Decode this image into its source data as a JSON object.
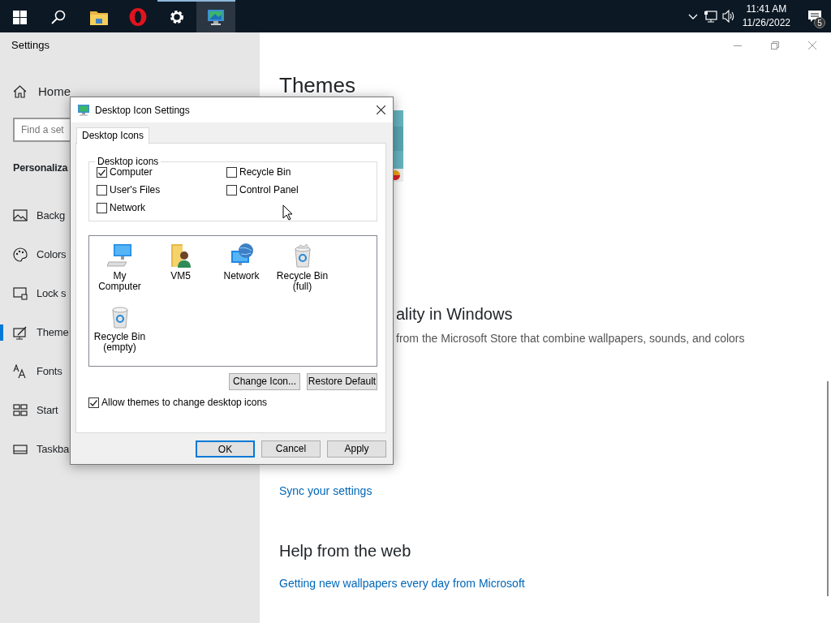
{
  "taskbar": {
    "apps": [
      {
        "kind": "start",
        "running": false,
        "selected": false
      },
      {
        "kind": "search",
        "running": false,
        "selected": false
      },
      {
        "kind": "folder",
        "running": false,
        "selected": false
      },
      {
        "kind": "browser",
        "running": false,
        "selected": false
      },
      {
        "kind": "settings",
        "running": true,
        "selected": false
      },
      {
        "kind": "display",
        "running": true,
        "selected": true
      }
    ],
    "tray": {
      "time": "11:41 AM",
      "date": "11/26/2022",
      "notification_count": "5"
    }
  },
  "settings_window": {
    "title": "Settings",
    "home": "Home",
    "search": {
      "placeholder": "Find a set"
    },
    "section": "Personaliza",
    "nav": [
      {
        "kind": "background",
        "label": "Backg",
        "selected": false
      },
      {
        "kind": "colors",
        "label": "Colors",
        "selected": false
      },
      {
        "kind": "lock",
        "label": "Lock s",
        "selected": false
      },
      {
        "kind": "themes",
        "label": "Theme",
        "selected": true
      },
      {
        "kind": "fonts",
        "label": "Fonts",
        "selected": false
      },
      {
        "kind": "start",
        "label": "Start",
        "selected": false
      },
      {
        "kind": "taskbar",
        "label": "Taskba",
        "selected": false
      }
    ],
    "page": {
      "title": "Themes",
      "heading": "ality in Windows",
      "description": "from the Microsoft Store that combine wallpapers, sounds, and colors",
      "sync_link": "Sync your settings",
      "help_title": "Help from the web",
      "help_link": "Getting new wallpapers every day from Microsoft"
    }
  },
  "dialog": {
    "title": "Desktop Icon Settings",
    "tabs": [
      {
        "label": "Desktop Icons",
        "selected": true
      }
    ],
    "group_label": "Desktop icons",
    "checkboxes": [
      {
        "label": "Computer",
        "checked": true
      },
      {
        "label": "Recycle Bin",
        "checked": false
      },
      {
        "label": "User's Files",
        "checked": false
      },
      {
        "label": "Control Panel",
        "checked": false
      },
      {
        "label": "Network",
        "checked": false
      }
    ],
    "icons": [
      {
        "kind": "computer",
        "label": "My Computer"
      },
      {
        "kind": "user",
        "label": "VM5"
      },
      {
        "kind": "network",
        "label": "Network"
      },
      {
        "kind": "bin_full",
        "label": "Recycle Bin (full)"
      },
      {
        "kind": "bin_empty",
        "label": "Recycle Bin (empty)"
      }
    ],
    "icon_buttons": [
      "Change Icon...",
      "Restore Default"
    ],
    "allow_themes": {
      "label": "Allow themes to change desktop icons",
      "checked": true
    },
    "buttons": [
      {
        "label": "OK",
        "default": true
      },
      {
        "label": "Cancel",
        "default": false
      },
      {
        "label": "Apply",
        "default": false
      }
    ]
  }
}
